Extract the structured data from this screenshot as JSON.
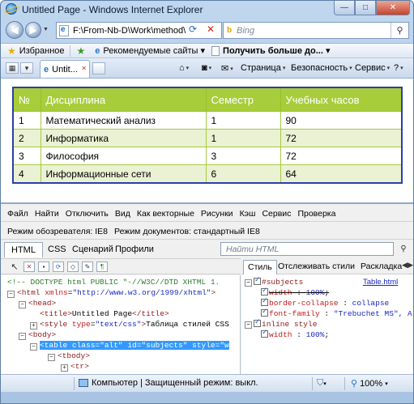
{
  "window": {
    "title": "Untitled Page - Windows Internet Explorer",
    "minimize": "—",
    "maximize": "□",
    "close": "✕"
  },
  "nav": {
    "address": "F:\\From-Nb-D\\Work\\method\\",
    "search_placeholder": "Bing"
  },
  "favorites": {
    "label": "Избранное",
    "items": [
      "Рекомендуемые сайты ▾",
      "Получить больше до... ▾"
    ]
  },
  "tabs": {
    "active_label": "Untit..."
  },
  "commands": {
    "page": "Страница",
    "security": "Безопасность",
    "service": "Сервис"
  },
  "table": {
    "headers": [
      "№",
      "Дисциплина",
      "Семестр",
      "Учебных часов"
    ],
    "rows": [
      [
        "1",
        "Математический анализ",
        "1",
        "90"
      ],
      [
        "2",
        "Информатика",
        "1",
        "72"
      ],
      [
        "3",
        "Философия",
        "3",
        "72"
      ],
      [
        "4",
        "Информационные сети",
        "6",
        "64"
      ]
    ]
  },
  "devtools": {
    "menu": [
      "Файл",
      "Найти",
      "Отключить",
      "Вид",
      "Как векторные",
      "Рисунки",
      "Кэш",
      "Сервис",
      "Проверка"
    ],
    "browser_mode": "Режим обозревателя: IE8",
    "document_mode": "Режим документов: стандартный IE8",
    "tabs": [
      "HTML",
      "CSS",
      "Сценарий",
      "Профили"
    ],
    "search_placeholder": "Найти HTML",
    "tree": {
      "doctype": "<!-- DOCTYPE html PUBLIC \"-//W3C//DTD XHTML 1.",
      "html_open": "<html",
      "html_attr": "xmlns",
      "html_val": "\"http://www.w3.org/1999/xhtml\"",
      "head": "<head>",
      "title_open": "<title>",
      "title_text": "Untitled Page",
      "title_close": "</title>",
      "style_open": "<style",
      "style_attr": "type",
      "style_val": "\"text/css\"",
      "style_text": "Таблица стилей CSS",
      "body": "<body>",
      "table_sel": "<table class=\"alt\" id=\"subjects\" style=\"w",
      "tbody": "<tbody>",
      "tr": "<tr>"
    },
    "style_tabs": [
      "Стиль",
      "Отслеживать стили",
      "Раскладка"
    ],
    "rules": {
      "selector": "#subjects",
      "link": "Table.html",
      "p1_name": "width",
      "p1_val": "100%",
      "p2_name": "border-collapse",
      "p2_val": "collapse",
      "p3_name": "font-family",
      "p3_val": "\"Trebuchet MS\", A",
      "inline": "inline style",
      "p4_name": "width",
      "p4_val": "100%"
    }
  },
  "status": {
    "zone": "Компьютер | Защищенный режим: выкл.",
    "zoom": "100%"
  }
}
